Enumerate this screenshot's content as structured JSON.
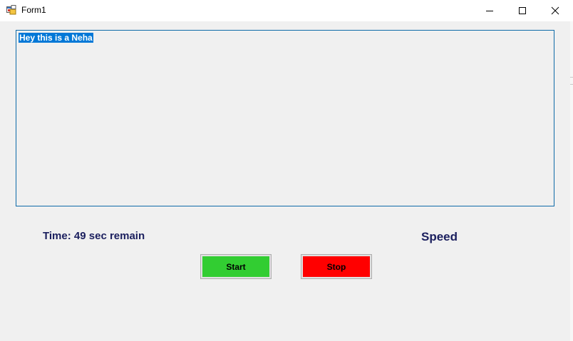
{
  "window": {
    "title": "Form1",
    "app_icon": "windows-form-icon",
    "controls": {
      "minimize_icon": "minimize-icon",
      "maximize_icon": "maximize-icon",
      "close_icon": "close-icon"
    }
  },
  "textbox": {
    "text": "Hey this is a Neha",
    "selected": true
  },
  "labels": {
    "time": "Time: 49 sec remain",
    "speed": "Speed"
  },
  "buttons": {
    "start": "Start",
    "stop": "Stop"
  },
  "colors": {
    "start_button": "#32cd32",
    "stop_button": "#ff0000",
    "label_text": "#1b1f5e",
    "selection": "#0078d7",
    "textbox_border": "#0e6aa8"
  }
}
